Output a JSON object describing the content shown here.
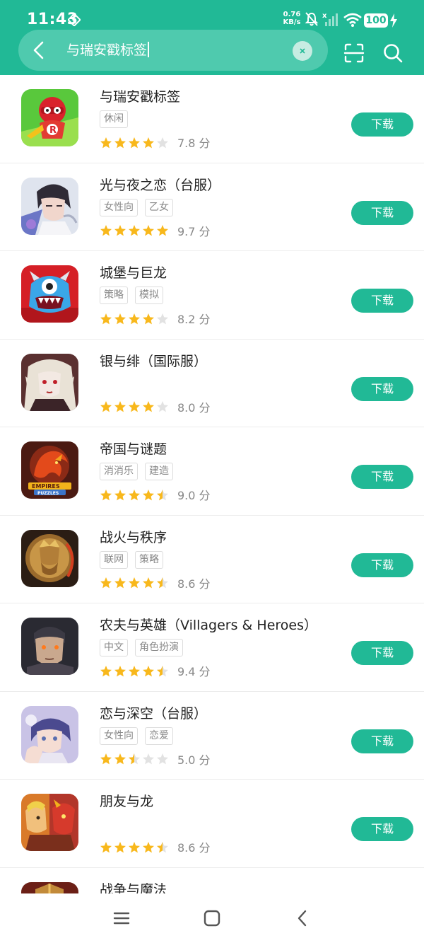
{
  "status_bar": {
    "time": "11:43",
    "net_speed_value": "0.76",
    "net_speed_unit": "KB/s",
    "battery": "100",
    "icons": [
      "sync-icon",
      "mute-icon",
      "signal-icon",
      "wifi-icon",
      "battery-icon",
      "charging-icon"
    ]
  },
  "search": {
    "query": "与瑞安戳标签",
    "icons": [
      "back-icon",
      "clear-icon",
      "scan-icon",
      "search-icon"
    ]
  },
  "colors": {
    "accent": "#21b996",
    "star_filled": "#f8b81c",
    "star_empty": "#e2e2e2",
    "tag_text": "#888888"
  },
  "download_label": "下载",
  "score_unit": "分",
  "apps": [
    {
      "name": "与瑞安戳标签",
      "tags": [
        "休闲"
      ],
      "score": "7.8",
      "rating": 4,
      "icon": "ryan-hero-icon"
    },
    {
      "name": "光与夜之恋（台服）",
      "tags": [
        "女性向",
        "乙女"
      ],
      "score": "9.7",
      "rating": 5,
      "icon": "anime-man-icon"
    },
    {
      "name": "城堡与巨龙",
      "tags": [
        "策略",
        "模拟"
      ],
      "score": "8.2",
      "rating": 4,
      "icon": "blue-monster-icon"
    },
    {
      "name": "银与绯（国际服）",
      "tags": [],
      "score": "8.0",
      "rating": 4,
      "icon": "vampire-girl-icon"
    },
    {
      "name": "帝国与谜题",
      "tags": [
        "消消乐",
        "建造"
      ],
      "score": "9.0",
      "rating": 4.5,
      "icon": "red-dragon-icon"
    },
    {
      "name": "战火与秩序",
      "tags": [
        "联网",
        "策略"
      ],
      "score": "8.6",
      "rating": 4.5,
      "icon": "king-coin-icon"
    },
    {
      "name": "农夫与英雄（Villagers & Heroes）",
      "tags": [
        "中文",
        "角色扮演"
      ],
      "score": "9.4",
      "rating": 4.5,
      "icon": "warrior-face-icon"
    },
    {
      "name": "恋与深空（台服）",
      "tags": [
        "女性向",
        "恋爱"
      ],
      "score": "5.0",
      "rating": 2.5,
      "icon": "anime-boy-icon"
    },
    {
      "name": "朋友与龙",
      "tags": [],
      "score": "8.6",
      "rating": 4.5,
      "icon": "hero-dragon-icon"
    },
    {
      "name": "战争与魔法",
      "tags": [],
      "score": "",
      "rating": 0,
      "icon": "war-magic-icon"
    }
  ],
  "nav_bar": {
    "icons": [
      "menu-icon",
      "home-icon",
      "back-nav-icon"
    ]
  }
}
